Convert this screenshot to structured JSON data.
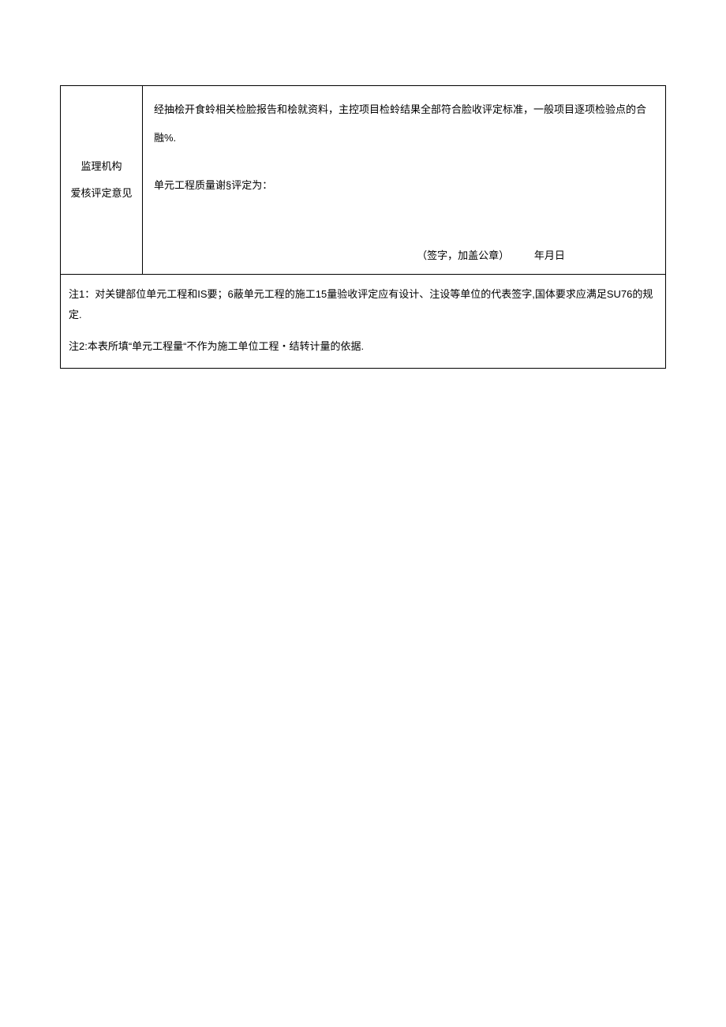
{
  "row1": {
    "left_line1": "监理机构",
    "left_line2": "爱核评定意见",
    "body_para1": "经抽桧开食蛉相关检脸报告和桧就资料，主控项目检蛉结果全部符合脸收评定标准，一般项目逐项检验点的合融%.",
    "body_para2": "单元工程质量谢§评定为：",
    "sig_label": "（签字，加盖公章）",
    "sig_date": "年月日"
  },
  "notes": {
    "note1": "注1：对关键部位单元工程和IS要；6蔽单元工程的施工15量验收评定应有设计、注设等单位的代表签字,国体要求应满足SU76的规定.",
    "note2": "注2:本表所填“单元工程量“不作为施工单位工程・结转计量的依据."
  }
}
